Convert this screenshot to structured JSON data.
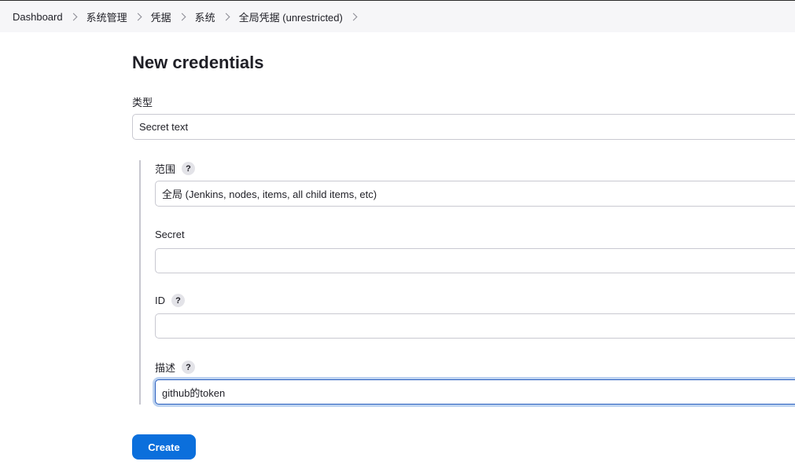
{
  "breadcrumb": {
    "items": [
      "Dashboard",
      "系统管理",
      "凭据",
      "系统",
      "全局凭据 (unrestricted)"
    ]
  },
  "page": {
    "title": "New credentials"
  },
  "form": {
    "type_label": "类型",
    "type_value": "Secret text",
    "scope_label": "范围",
    "scope_value": "全局 (Jenkins, nodes, items, all child items, etc)",
    "secret_label": "Secret",
    "secret_value": "",
    "id_label": "ID",
    "id_value": "",
    "description_label": "描述",
    "description_value": "github的token",
    "help_glyph": "?",
    "create_label": "Create"
  },
  "colors": {
    "primary_button": "#0b6fdc",
    "focus_ring": "#bcd2f0",
    "breadcrumb_bg": "#f6f6f8"
  }
}
